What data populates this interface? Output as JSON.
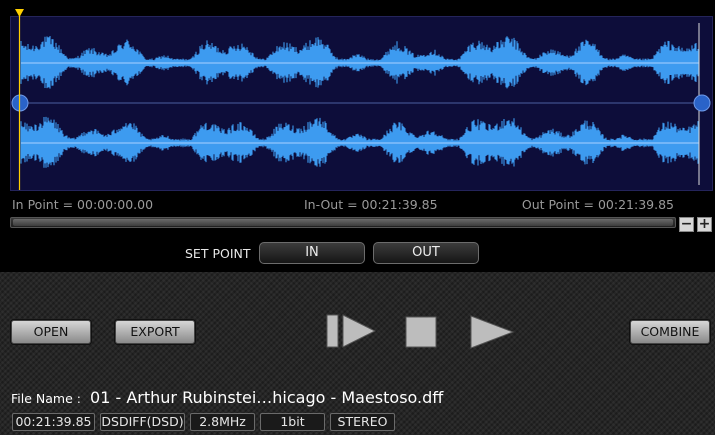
{
  "points": {
    "in_point": "In Point = 00:00:00.00",
    "in_out": "In-Out = 00:21:39.85",
    "out_point": "Out Point = 00:21:39.85"
  },
  "set_point": {
    "label": "SET POINT",
    "in_label": "IN",
    "out_label": "OUT"
  },
  "zoom": {
    "minus": "−",
    "plus": "+"
  },
  "buttons": {
    "open": "OPEN",
    "export": "EXPORT",
    "combine": "COMBINE"
  },
  "file": {
    "name_label": "File Name :",
    "name_value": "01 - Arthur Rubinstei…hicago - Maestoso.dff",
    "duration": "00:21:39.85",
    "format": "DSDIFF(DSD)",
    "rate": "2.8MHz",
    "bits": "1bit",
    "channels": "STEREO"
  },
  "colors": {
    "waveform": "#3d9bf0",
    "waveform_bg": "#0d0d3a",
    "cursor": "#ffd000",
    "handle": "#2a63c8"
  },
  "icons": {
    "play_from_start": "skip-to-start-play-icon",
    "stop": "stop-icon",
    "play": "play-icon"
  }
}
